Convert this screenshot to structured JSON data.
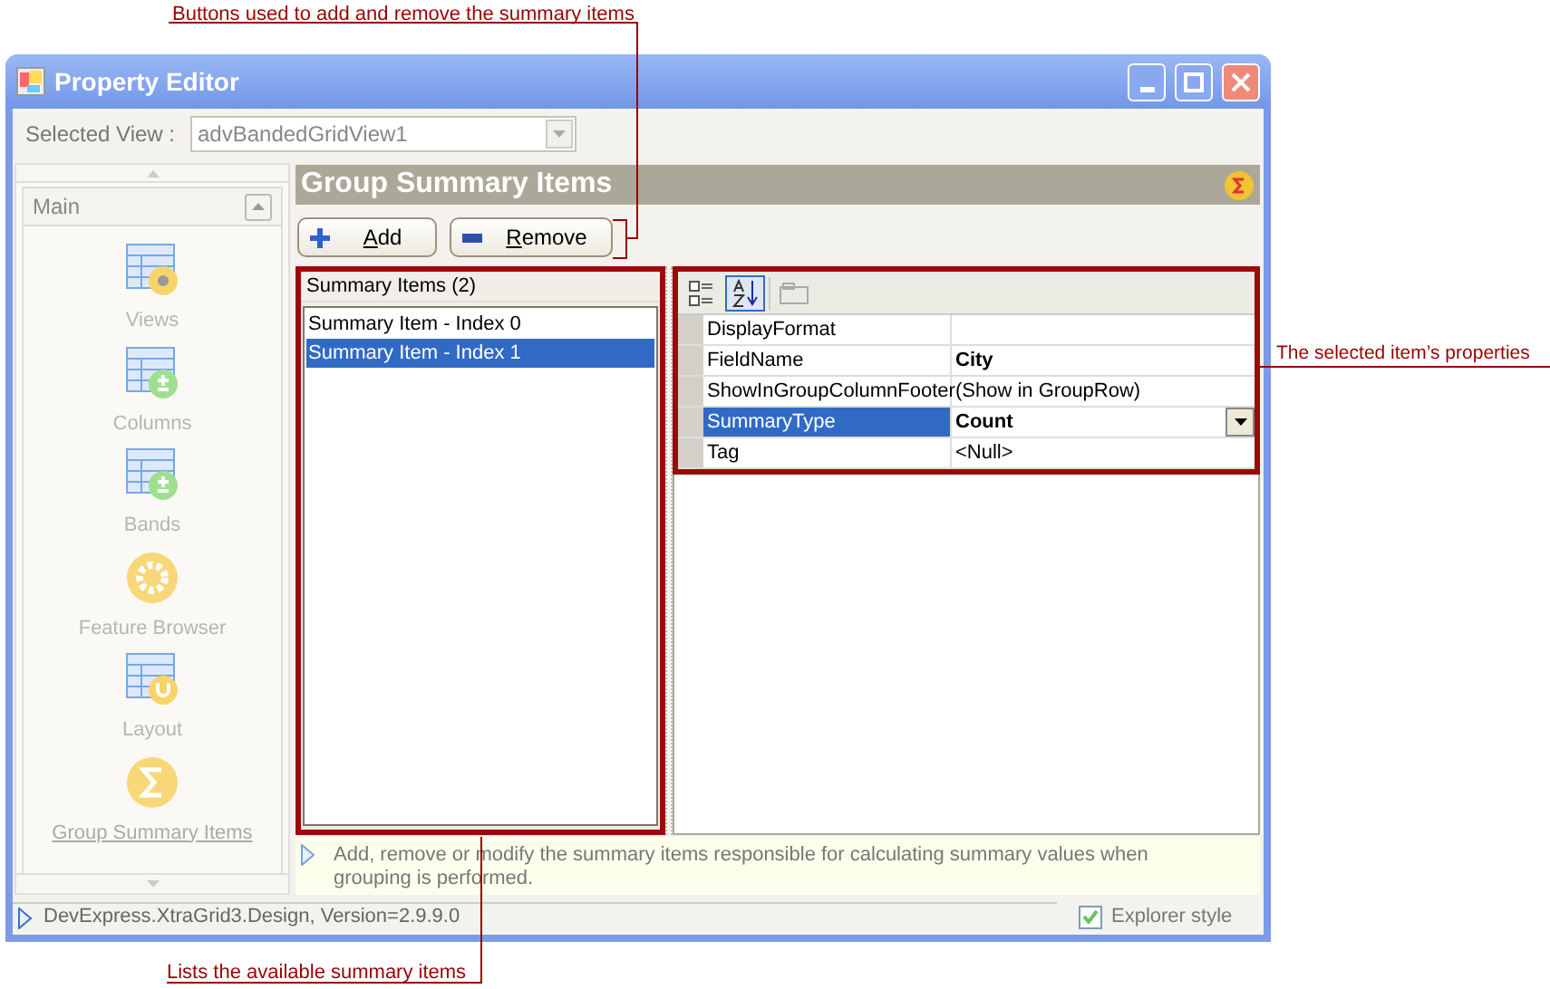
{
  "callouts": [
    {
      "text": "Buttons used to add and remove the summary items"
    },
    {
      "text": "The selected item’s properties"
    },
    {
      "text": "Lists the available summary items"
    }
  ],
  "window": {
    "title": "Property Editor"
  },
  "selected_view": {
    "label": "Selected View :",
    "value": "advBandedGridView1"
  },
  "nav": {
    "group": "Main",
    "items": [
      {
        "label": "Views",
        "kind": "views",
        "selected": false
      },
      {
        "label": "Columns",
        "kind": "columns",
        "selected": false
      },
      {
        "label": "Bands",
        "kind": "bands",
        "selected": false
      },
      {
        "label": "Feature Browser",
        "kind": "gear",
        "selected": false
      },
      {
        "label": "Layout",
        "kind": "layout",
        "selected": false
      },
      {
        "label": "Group Summary Items",
        "kind": "sigma",
        "selected": true
      }
    ]
  },
  "page": {
    "title": "Group Summary Items",
    "buttons": [
      {
        "label": "Add",
        "kind": "add"
      },
      {
        "label": "Remove",
        "kind": "remove"
      }
    ],
    "list": {
      "header": "Summary Items (2)",
      "items": [
        {
          "label": "Summary Item - Index 0",
          "selected": false
        },
        {
          "label": "Summary Item - Index 1",
          "selected": true
        }
      ]
    },
    "grid": {
      "toolbar": [
        {
          "kind": "categorized",
          "selected": false
        },
        {
          "kind": "alphabetical",
          "selected": true
        },
        {
          "kind": "pages",
          "selected": false
        }
      ],
      "rows": [
        {
          "name": "DisplayFormat",
          "selected": false
        },
        {
          "name": "FieldName",
          "value": "City",
          "bold": true,
          "selected": false
        },
        {
          "name": "ShowInGroupColumnFooter",
          "value": "(Show in GroupRow)",
          "bold": false,
          "selected": false
        },
        {
          "name": "SummaryType",
          "value": "Count",
          "bold": true,
          "selected": true
        },
        {
          "name": "Tag",
          "value": "<Null>",
          "bold": false,
          "selected": false
        }
      ]
    },
    "description": "Add, remove or modify the summary items responsible for calculating summary values when grouping is performed."
  },
  "status_bar": {
    "text": "DevExpress.XtraGrid3.Design, Version=2.9.9.0",
    "explorer_style": {
      "label": "Explorer style",
      "checked": true
    }
  }
}
